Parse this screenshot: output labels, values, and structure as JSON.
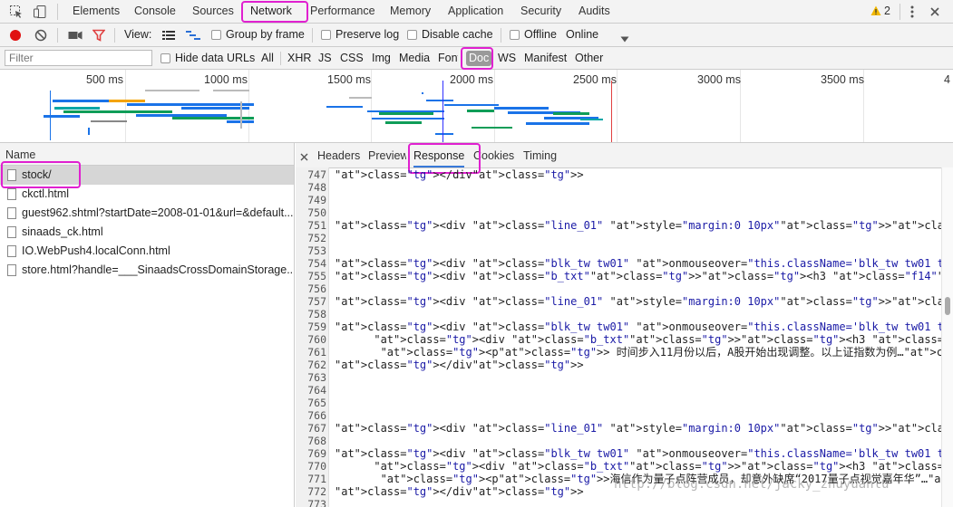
{
  "tabbar": {
    "tabs": [
      "Elements",
      "Console",
      "Sources",
      "Network",
      "Performance",
      "Memory",
      "Application",
      "Security",
      "Audits"
    ],
    "active": "Network",
    "warning_count": "2"
  },
  "toolbar": {
    "view_label": "View:",
    "group_by_frame": "Group by frame",
    "preserve_log": "Preserve log",
    "disable_cache": "Disable cache",
    "offline": "Offline",
    "throttle": "Online"
  },
  "filterbar": {
    "placeholder": "Filter",
    "hide_data_urls": "Hide data URLs",
    "types": [
      "All",
      "XHR",
      "JS",
      "CSS",
      "Img",
      "Media",
      "Font",
      "Doc",
      "WS",
      "Manifest",
      "Other"
    ],
    "active_type": "Doc"
  },
  "overview": {
    "ticks": [
      "500 ms",
      "1000 ms",
      "1500 ms",
      "2000 ms",
      "2500 ms",
      "3000 ms",
      "3500 ms",
      "4"
    ]
  },
  "requests": {
    "header": "Name",
    "items": [
      "stock/",
      "ckctl.html",
      "guest962.shtml?startDate=2008-01-01&url=&default...",
      "sinaads_ck.html",
      "IO.WebPush4.localConn.html",
      "store.html?handle=___SinaadsCrossDomainStorage..."
    ],
    "selected": 0
  },
  "detail": {
    "tabs": [
      "Headers",
      "Preview",
      "Response",
      "Cookies",
      "Timing"
    ],
    "active": "Response",
    "lines": [
      {
        "n": "747",
        "t": "</div>"
      },
      {
        "n": "748",
        "t": ""
      },
      {
        "n": "749",
        "t": ""
      },
      {
        "n": "750",
        "t": ""
      },
      {
        "n": "751",
        "t": "<div class=\"line_01\" style=\"margin:0 10px\"></div>"
      },
      {
        "n": "752",
        "t": ""
      },
      {
        "n": "753",
        "t": ""
      },
      {
        "n": "754",
        "t": "<div class=\"blk_tw tw01\" onmouseover=\"this.className='blk_tw tw01 tw01_hover'\" onmouseout=\"th"
      },
      {
        "n": "755",
        "t": "<div class=\"b_txt\"><h3 class=\"f14\"><a href=\"http://blog.sina.com.cn/s/blog_8db3ce3d0102zbyc.h"
      },
      {
        "n": "756",
        "t": ""
      },
      {
        "n": "757",
        "t": "<div class=\"line_01\" style=\"margin:0 10px\"></div>"
      },
      {
        "n": "758",
        "t": ""
      },
      {
        "n": "759",
        "t": "<div class=\"blk_tw tw01\" onmouseover=\"this.className='blk_tw tw01 tw01_hover'\" onmouseout=\"th"
      },
      {
        "n": "760",
        "t": "      <div class=\"b_txt\"><h3 class=\"f14\"><a href=\"http://blog.sina.com.cn/s/blog_4151be0f010"
      },
      {
        "n": "761",
        "t": "       <p> 时间步入11月份以后，A股开始出现调整。以上证指数为例…<a href=\"http://blog.sina.com.cn/s/b"
      },
      {
        "n": "762",
        "t": "</div>"
      },
      {
        "n": "763",
        "t": ""
      },
      {
        "n": "764",
        "t": ""
      },
      {
        "n": "765",
        "t": ""
      },
      {
        "n": "766",
        "t": ""
      },
      {
        "n": "767",
        "t": "<div class=\"line_01\" style=\"margin:0 10px\"></div>"
      },
      {
        "n": "768",
        "t": ""
      },
      {
        "n": "769",
        "t": "<div class=\"blk_tw tw01\" onmouseover=\"this.className='blk_tw tw01 tw01_hover'\" onmouseout=\"th"
      },
      {
        "n": "770",
        "t": "      <div class=\"b_txt\"><h3 class=\"f14\"><a href=\"http://blog.sina.com.cn/s/blog_4721b169010"
      },
      {
        "n": "771",
        "t": "       <p>海信作为量子点阵营成员，却意外缺席“2017量子点视觉嘉年华”…<a href=\"http://blog.sina.com.cn/"
      },
      {
        "n": "772",
        "t": "</div>"
      },
      {
        "n": "773",
        "t": ""
      }
    ]
  },
  "watermark": "http://blog.csdn.net/jacky_zhuyuanlu",
  "colors": {
    "highlight": "#e020d0",
    "record": "#e01010",
    "filter_icon": "#e04040",
    "active_tab_text": "#333333",
    "doc_badge": "#9a9a9a",
    "waterfall_blue": "#1a73e8",
    "waterfall_green": "#0f9d58",
    "waterfall_orange": "#f4a300",
    "waterfall_teal": "#00a6a6",
    "load_line": "#e04040",
    "domcontent_line": "#3030ff"
  }
}
